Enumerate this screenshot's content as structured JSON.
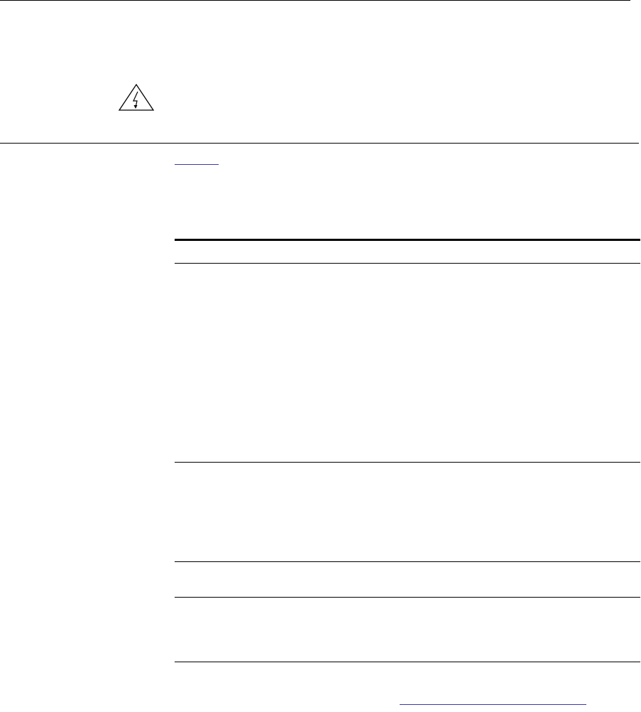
{
  "page": {
    "warning_icon": "electrical-hazard-icon",
    "link_color": "#3a3aa8"
  },
  "table": {
    "header": [],
    "rows": [
      [],
      [],
      [],
      []
    ]
  }
}
